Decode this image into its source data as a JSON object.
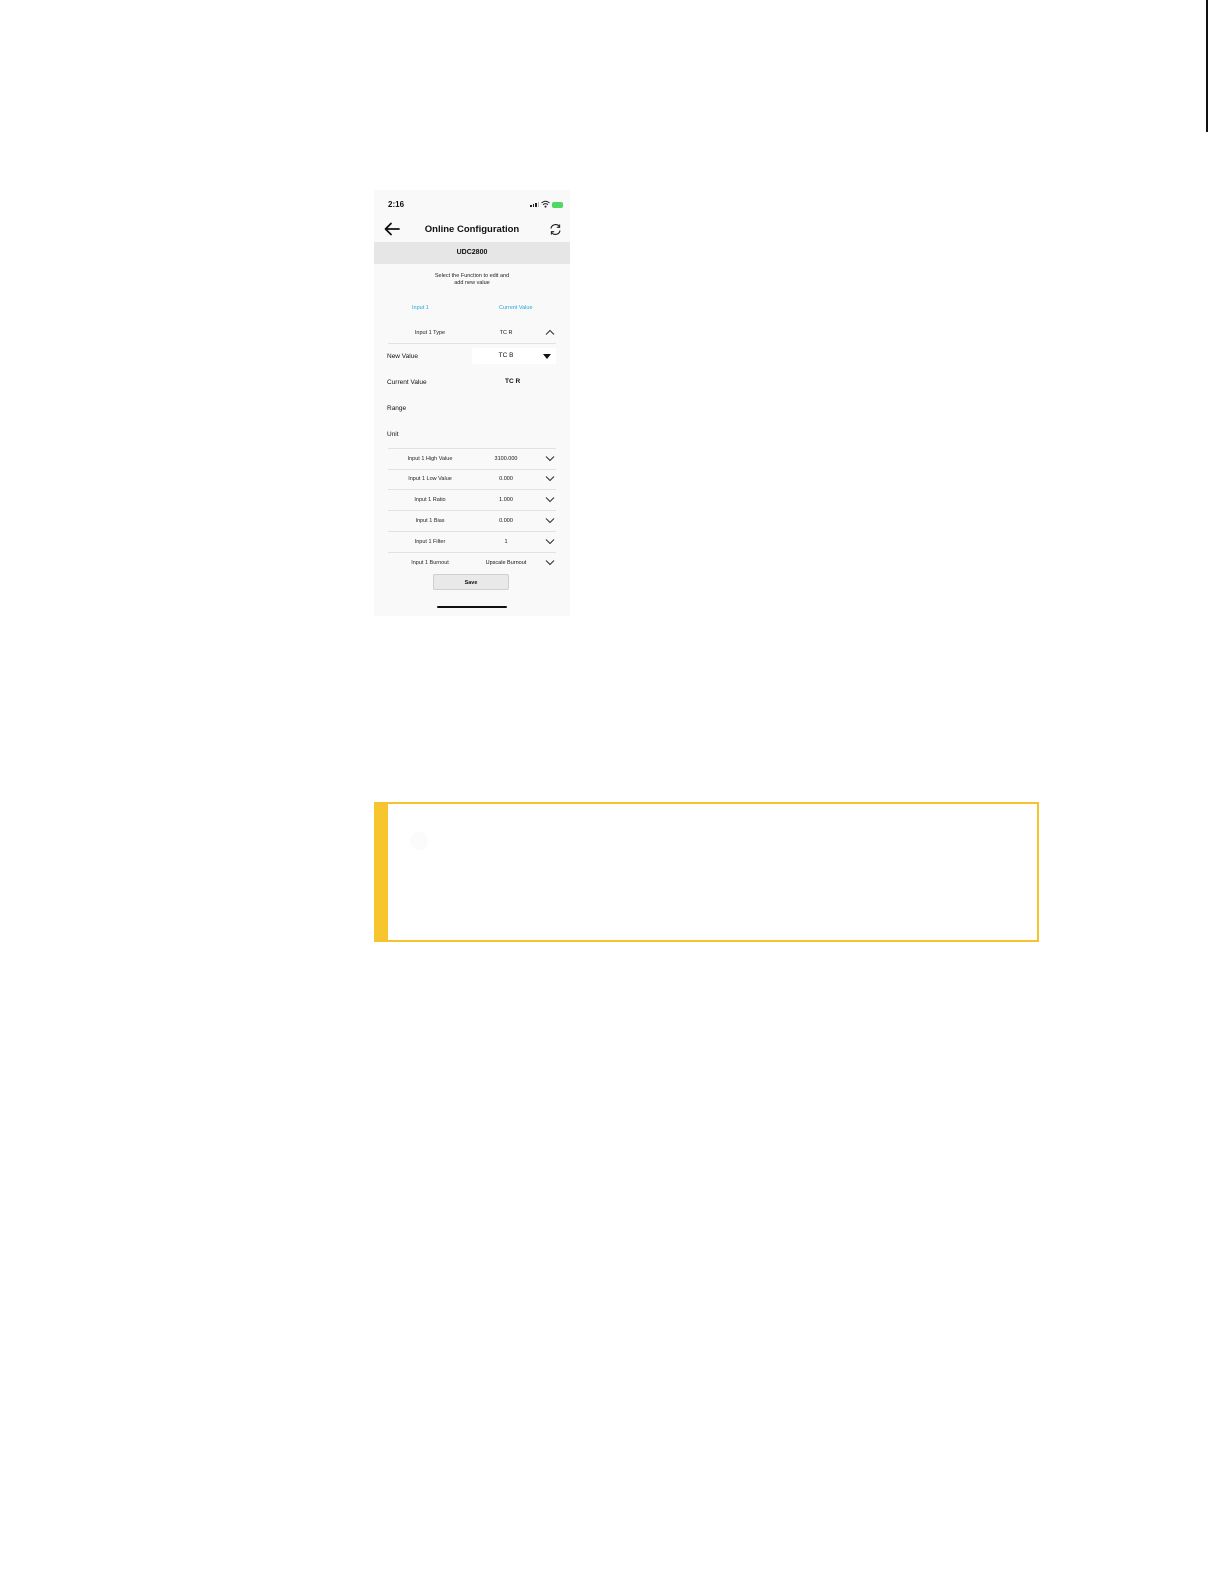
{
  "status_bar": {
    "time": "2:16"
  },
  "header": {
    "title": "Online Configuration",
    "icons": [
      "back-arrow-icon",
      "refresh-icon"
    ]
  },
  "device": {
    "name": "UDC2800"
  },
  "instruction": {
    "line1": "Select the Function to edit and",
    "line2": "add new value"
  },
  "tabs": {
    "input": "Input 1",
    "current": "Current Value"
  },
  "expanded_row": {
    "label": "Input 1 Type",
    "value": "TC R"
  },
  "detail": {
    "new_value_label": "New Value",
    "new_value_selected": "TC B",
    "current_value_label": "Current Value",
    "current_value": "TC R",
    "range_label": "Range",
    "unit_label": "Unit"
  },
  "rows": [
    {
      "label": "Input 1 High Value",
      "value": "3100.000"
    },
    {
      "label": "Input 1 Low Value",
      "value": "0.000"
    },
    {
      "label": "Input 1 Ratio",
      "value": "1.000"
    },
    {
      "label": "Input 1 Bias",
      "value": "0.000"
    },
    {
      "label": "Input 1 Filter",
      "value": "1"
    },
    {
      "label": "Input 1 Burnout",
      "value": "Upscale Burnout"
    }
  ],
  "save_button": {
    "label": "Save"
  },
  "colors": {
    "tab_accent": "#23a6d8",
    "note_border": "#f5c230",
    "battery": "#4cd964"
  }
}
